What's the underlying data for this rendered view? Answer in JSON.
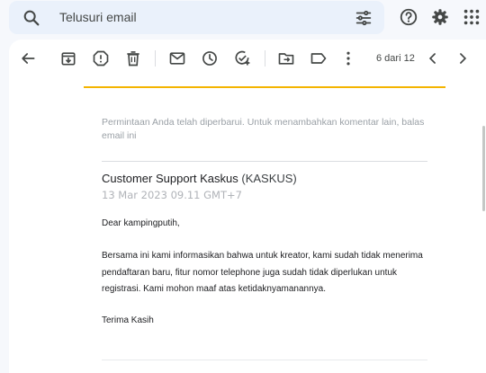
{
  "search": {
    "placeholder": "Telusuri email",
    "search_icon": "search-icon",
    "filter_icon": "tune-icon"
  },
  "top_icons": [
    "help-icon",
    "settings-icon",
    "apps-icon"
  ],
  "toolbar": {
    "icons": [
      "back-arrow-icon",
      "archive-icon",
      "report-spam-icon",
      "delete-icon",
      "mark-unread-icon",
      "snooze-icon",
      "add-task-icon",
      "move-to-icon",
      "label-icon",
      "more-icon"
    ],
    "pager_text": "6 dari 12"
  },
  "email": {
    "notice": "Permintaan Anda telah diperbarui. Untuk menambahkan komentar lain, balas email ini",
    "sender_name": "Customer Support Kaskus",
    "sender_org": "(KASKUS)",
    "date": "13 Mar 2023 09.11 GMT+7",
    "greeting": "Dear kampingputih,",
    "paragraph": "Bersama ini kami informasikan bahwa untuk kreator, kami sudah tidak menerima pendaftaran baru, fitur nomor telephone juga sudah tidak diperlukan untuk registrasi. Kami mohon maaf atas ketidaknyamanannya.",
    "signoff": "Terima Kasih"
  },
  "colors": {
    "accent_line": "#f4b400",
    "search_bg": "#eaf1fb",
    "page_bg": "#f6f8fc"
  }
}
